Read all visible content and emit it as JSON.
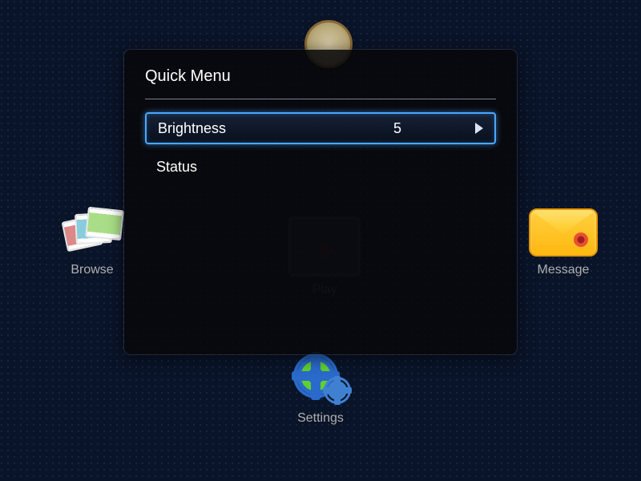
{
  "menu": {
    "title": "Quick Menu",
    "items": [
      {
        "label": "Brightness",
        "value": "5",
        "selected": true
      },
      {
        "label": "Status",
        "value": "",
        "selected": false
      }
    ]
  },
  "home": {
    "browse_label": "Browse",
    "play_label": "Play",
    "message_label": "Message",
    "settings_label": "Settings"
  }
}
